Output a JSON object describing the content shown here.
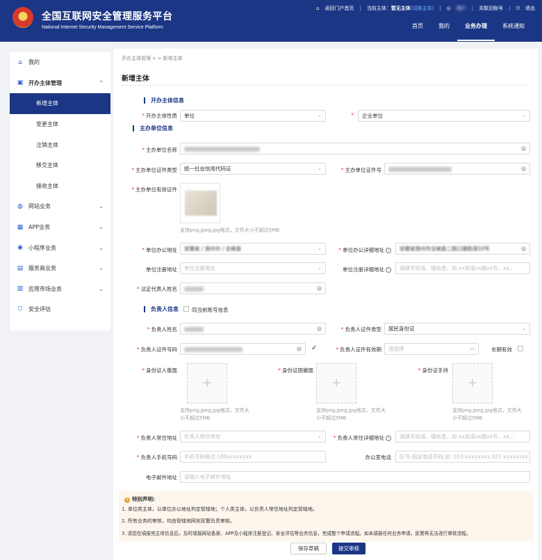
{
  "header": {
    "title": "全国互联网安全管理服务平台",
    "subtitle": "National Internet Security Management Service Platform",
    "portal_link": "返回门户首页",
    "current_subject_label": "当前主体：",
    "current_subject_value": "暂无主体",
    "switch_subject": "(切换主体)",
    "user_name": "用户",
    "link_account": "关联旧账号",
    "logout": "退出",
    "nav": [
      "首页",
      "我的",
      "业务办理",
      "系统通知"
    ]
  },
  "sidebar": {
    "items": [
      {
        "label": "我的",
        "icon": "home-icon"
      },
      {
        "label": "开办主体管理",
        "icon": "briefcase-icon"
      },
      {
        "label": "新增主体"
      },
      {
        "label": "变更主体"
      },
      {
        "label": "注销主体"
      },
      {
        "label": "移交主体"
      },
      {
        "label": "接收主体"
      },
      {
        "label": "网站业务",
        "icon": "globe-icon"
      },
      {
        "label": "APP业务",
        "icon": "apps-icon"
      },
      {
        "label": "小程序业务",
        "icon": "compass-icon"
      },
      {
        "label": "服务商业务",
        "icon": "service-icon"
      },
      {
        "label": "应用市场业务",
        "icon": "store-icon"
      },
      {
        "label": "安全评估",
        "icon": "shield-icon"
      }
    ]
  },
  "breadcrumb": {
    "parent": "开办主体管理",
    "current": "新增主体"
  },
  "page_title": "新增主体",
  "sections": {
    "owner_info": "开办主体信息",
    "sponsor_info": "主办单位信息",
    "person_info": "负责人信息"
  },
  "form": {
    "nature_label": "开办主体性质",
    "nature_value": "单位",
    "nature_type_value": "企业单位",
    "unit_name_label": "主办单位名称",
    "cert_type_label": "主办单位证件类型",
    "cert_type_value": "统一社会信用代码证",
    "cert_no_label": "主办单位证件号",
    "valid_cert_label": "主办单位有效证件",
    "upload_hint": "支持png,jpeg,jpg格式，文件大小不超过5MB",
    "office_addr_label": "单位办公地址",
    "office_addr_value": "安徽省 / 滁州市 / 全椒县",
    "office_detail_label": "单位办公详细地址",
    "office_detail_value": "安徽省滁州市全椒县二郎口镇街道10号",
    "reg_addr_label": "单位注册地址",
    "reg_addr_placeholder": "单位注册地址",
    "reg_detail_label": "单位注册详细地址",
    "reg_detail_placeholder": "请填写街道、镇信息，如 xx街道xx路xx号，xx...",
    "legal_rep_label": "法定代表人姓名",
    "same_as_account_label": "同当前账号信息",
    "person_name_label": "负责人姓名",
    "person_cert_type_label": "负责人证件类型",
    "person_cert_type_value": "居民身份证",
    "person_cert_no_label": "负责人证件号码",
    "person_cert_valid_label": "负责人证件有效期",
    "person_cert_valid_placeholder": "请选择",
    "long_term_label": "长期有效",
    "id_front_label": "身份证人像面",
    "id_back_label": "身份证国徽面",
    "id_hand_label": "身份证手持",
    "id_hint_1": "支持png,jpeg,jpg格式，文件大",
    "id_hint_2": "小不超过5MB",
    "residence_label": "负责人常住地址",
    "residence_placeholder": "负责人常住地址",
    "residence_detail_label": "负责人常住详细地址",
    "residence_detail_placeholder": "请填写街道、镇信息，如 xx街道xx路xx号，xx...",
    "mobile_label": "负责人手机号码",
    "mobile_placeholder": "手机号码格式:186xxxxxxxx",
    "office_phone_label": "办公室电话",
    "office_phone_placeholder": "区号-固定电话号码,如: 010-xxxxxxxx,021-xxxxxxxx",
    "email_label": "电子邮件地址",
    "email_placeholder": "请输入电子邮件地址"
  },
  "notice": {
    "title": "特别声明:",
    "lines": [
      "1. 单位类主体，以单位办公地址判定管辖地；个人类主体，以负责人常住地址判定管辖地。",
      "2. 所有业务的审核，均由管辖地网安民警负责审核。",
      "3. 请您在填报完主体信息后，及时填报网站备案、APP及小程序注册登记、安全评估等业务信息，完成整个申请流程。如未填报任何业务申请，民警将无法进行审核流程。"
    ]
  },
  "buttons": {
    "save_draft": "保存草稿",
    "submit": "提交审核"
  },
  "colors": {
    "primary": "#1b3685",
    "required": "#ee4433",
    "notice_bg": "#fdf6ec"
  }
}
